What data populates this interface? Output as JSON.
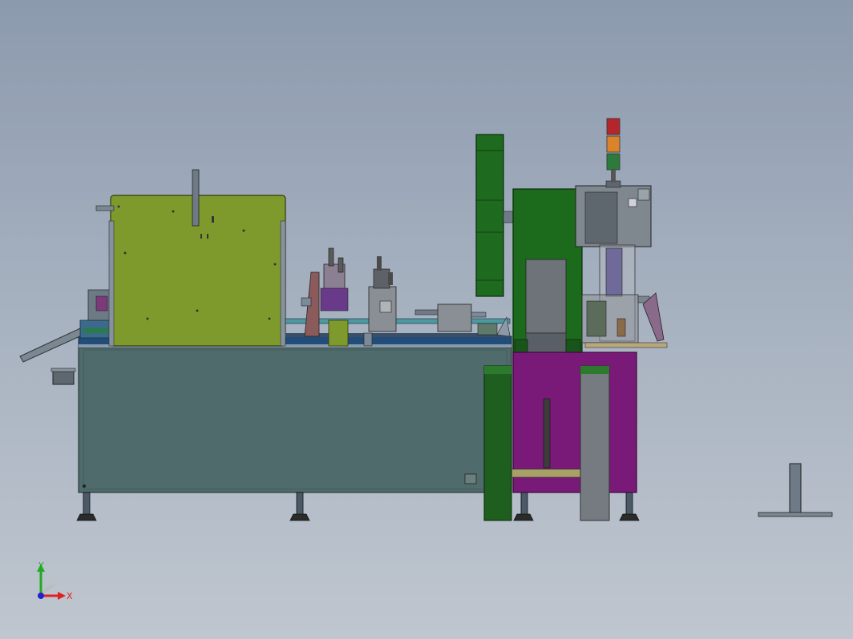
{
  "viewport": {
    "background_top": "#8c9aae",
    "background_bottom": "#bfc6cf"
  },
  "colors": {
    "base_cabinet": "#4f6b6b",
    "feeder_hood": "#7e9a2c",
    "press_frame": "#1c6b1c",
    "press_base": "#7a1a78",
    "flywheel": "#1e6a1e",
    "signal_red": "#b3262b",
    "signal_amber": "#d9842b",
    "signal_green": "#2c7a3c",
    "axis_x": "#d22",
    "axis_y": "#2a2",
    "axis_z": "#22c"
  },
  "triad": {
    "x_label": "X",
    "y_label": "Y"
  },
  "signal_tower": {
    "lights": [
      "red",
      "amber",
      "green"
    ]
  }
}
